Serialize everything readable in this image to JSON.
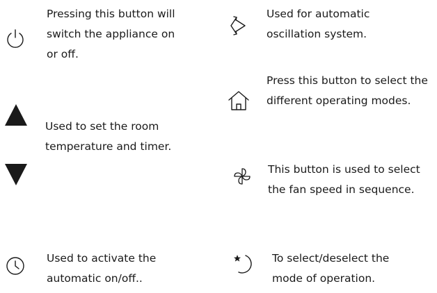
{
  "colors": {
    "text": "#1a1a1a",
    "icon": "#1a1a1a"
  },
  "items": [
    {
      "icon": "power-icon",
      "lines": [
        "Pressing this button will",
        "switch the appliance on",
        "or off."
      ]
    },
    {
      "icon": "oscillation-icon",
      "lines": [
        "Used for automatic",
        "oscillation system."
      ]
    },
    {
      "icon": "home-icon",
      "lines": [
        "Press this button to select the",
        "different operating modes."
      ]
    },
    {
      "icon": "up-triangle-icon",
      "icon2": "down-triangle-icon",
      "lines": [
        "Used to set the room",
        "temperature and timer."
      ]
    },
    {
      "icon": "fan-icon",
      "lines": [
        "This button is used to select",
        "the fan speed in sequence."
      ]
    },
    {
      "icon": "clock-icon",
      "lines": [
        "Used to activate the",
        "automatic on/off.."
      ]
    },
    {
      "icon": "sleep-icon",
      "lines": [
        "To select/deselect the",
        "mode of operation."
      ]
    }
  ]
}
